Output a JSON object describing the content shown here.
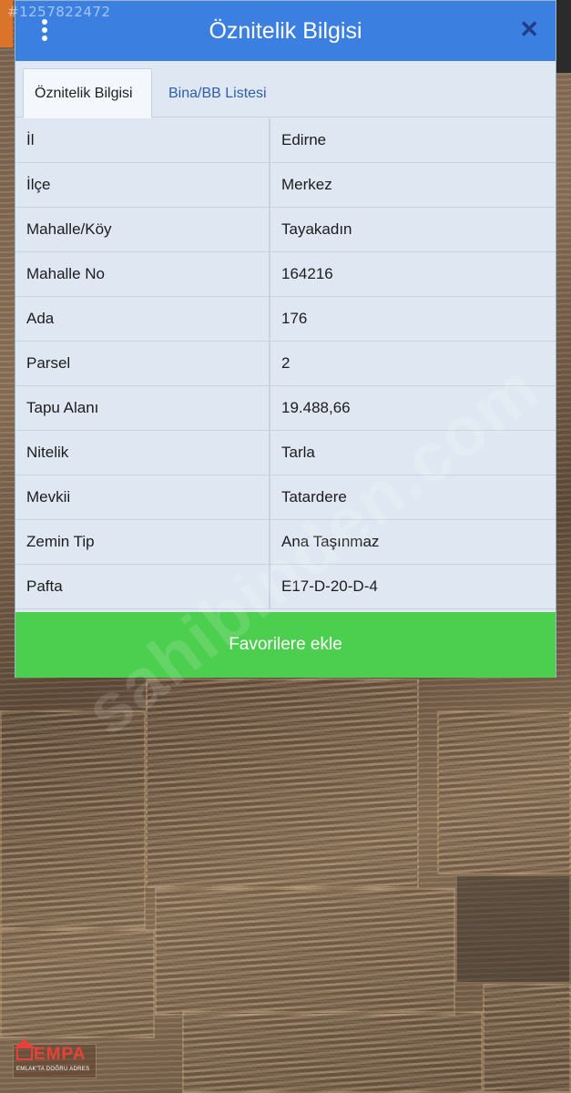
{
  "watermark": {
    "listing_id": "#1257822472",
    "site": "sahibinden.com"
  },
  "dialog": {
    "title": "Öznitelik Bilgisi",
    "menu_icon": "more-vertical-icon",
    "close_icon": "close-icon",
    "tabs": [
      {
        "label": "Öznitelik Bilgisi",
        "active": true
      },
      {
        "label": "Bina/BB Listesi",
        "active": false
      }
    ],
    "rows": [
      {
        "key": "İl",
        "value": "Edirne"
      },
      {
        "key": "İlçe",
        "value": "Merkez"
      },
      {
        "key": "Mahalle/Köy",
        "value": "Tayakadın"
      },
      {
        "key": "Mahalle No",
        "value": "164216"
      },
      {
        "key": "Ada",
        "value": "176"
      },
      {
        "key": "Parsel",
        "value": "2"
      },
      {
        "key": "Tapu Alanı",
        "value": "19.488,66"
      },
      {
        "key": "Nitelik",
        "value": "Tarla"
      },
      {
        "key": "Mevkii",
        "value": "Tatardere"
      },
      {
        "key": "Zemin Tip",
        "value": "Ana Taşınmaz"
      },
      {
        "key": "Pafta",
        "value": "E17-D-20-D-4"
      }
    ],
    "favorite_button": "Favorilere ekle"
  },
  "logo": {
    "name": "EMPA",
    "tagline": "EMLAK'TA DOĞRU ADRES"
  },
  "colors": {
    "header": "#3b7fe0",
    "favorite": "#4cce4f",
    "close": "#1e3e8a"
  }
}
